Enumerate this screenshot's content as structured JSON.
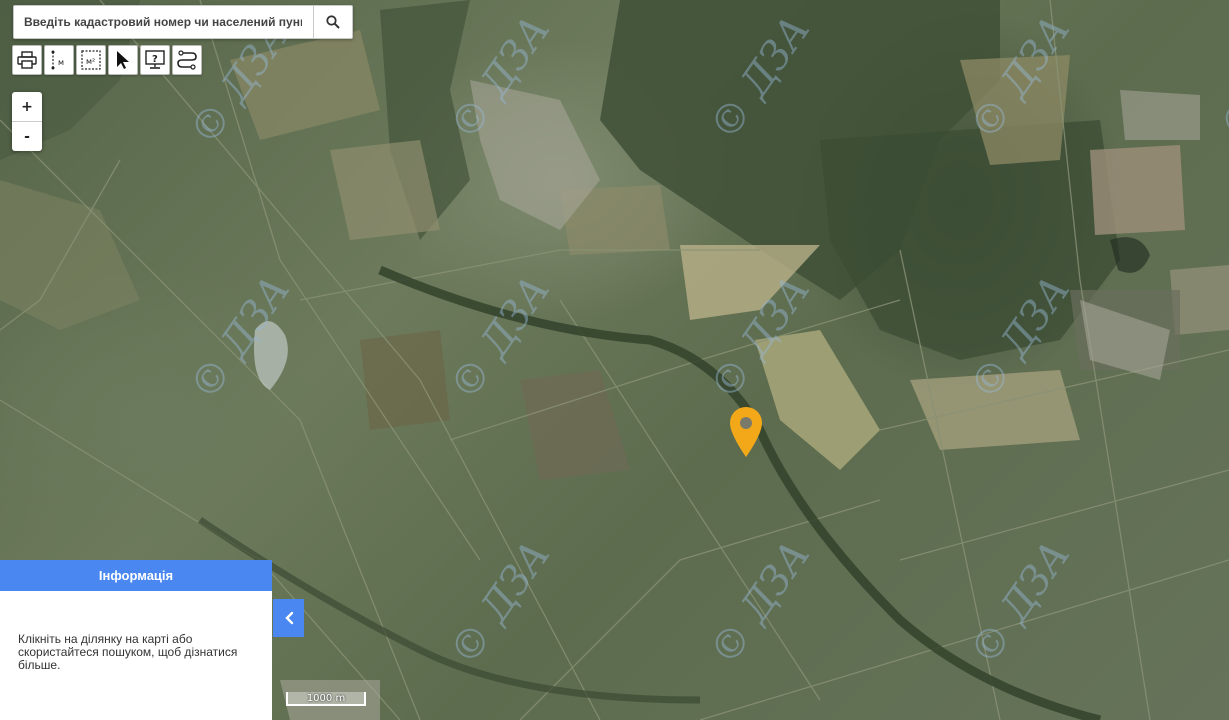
{
  "search": {
    "placeholder": "Введіть кадастровий номер чи населений пункт"
  },
  "icons": {
    "search": "search-icon",
    "toolbar": [
      "printer-icon",
      "measure-distance-icon",
      "measure-area-icon",
      "pointer-icon",
      "info-monitor-icon",
      "route-icon"
    ]
  },
  "toolbar": {
    "distance_unit": "м",
    "area_unit": "м²"
  },
  "zoom": {
    "in_label": "+",
    "out_label": "-"
  },
  "map": {
    "watermark": "© ДЗА",
    "marker_color": "#f3a81a"
  },
  "info_panel": {
    "title": "Інформація",
    "body": "Клікніть на ділянку на карті або скористайтеся пошуком, щоб дізнатися більше.",
    "accent_color": "#4a87f0"
  },
  "scale": {
    "label": "1000 m"
  }
}
